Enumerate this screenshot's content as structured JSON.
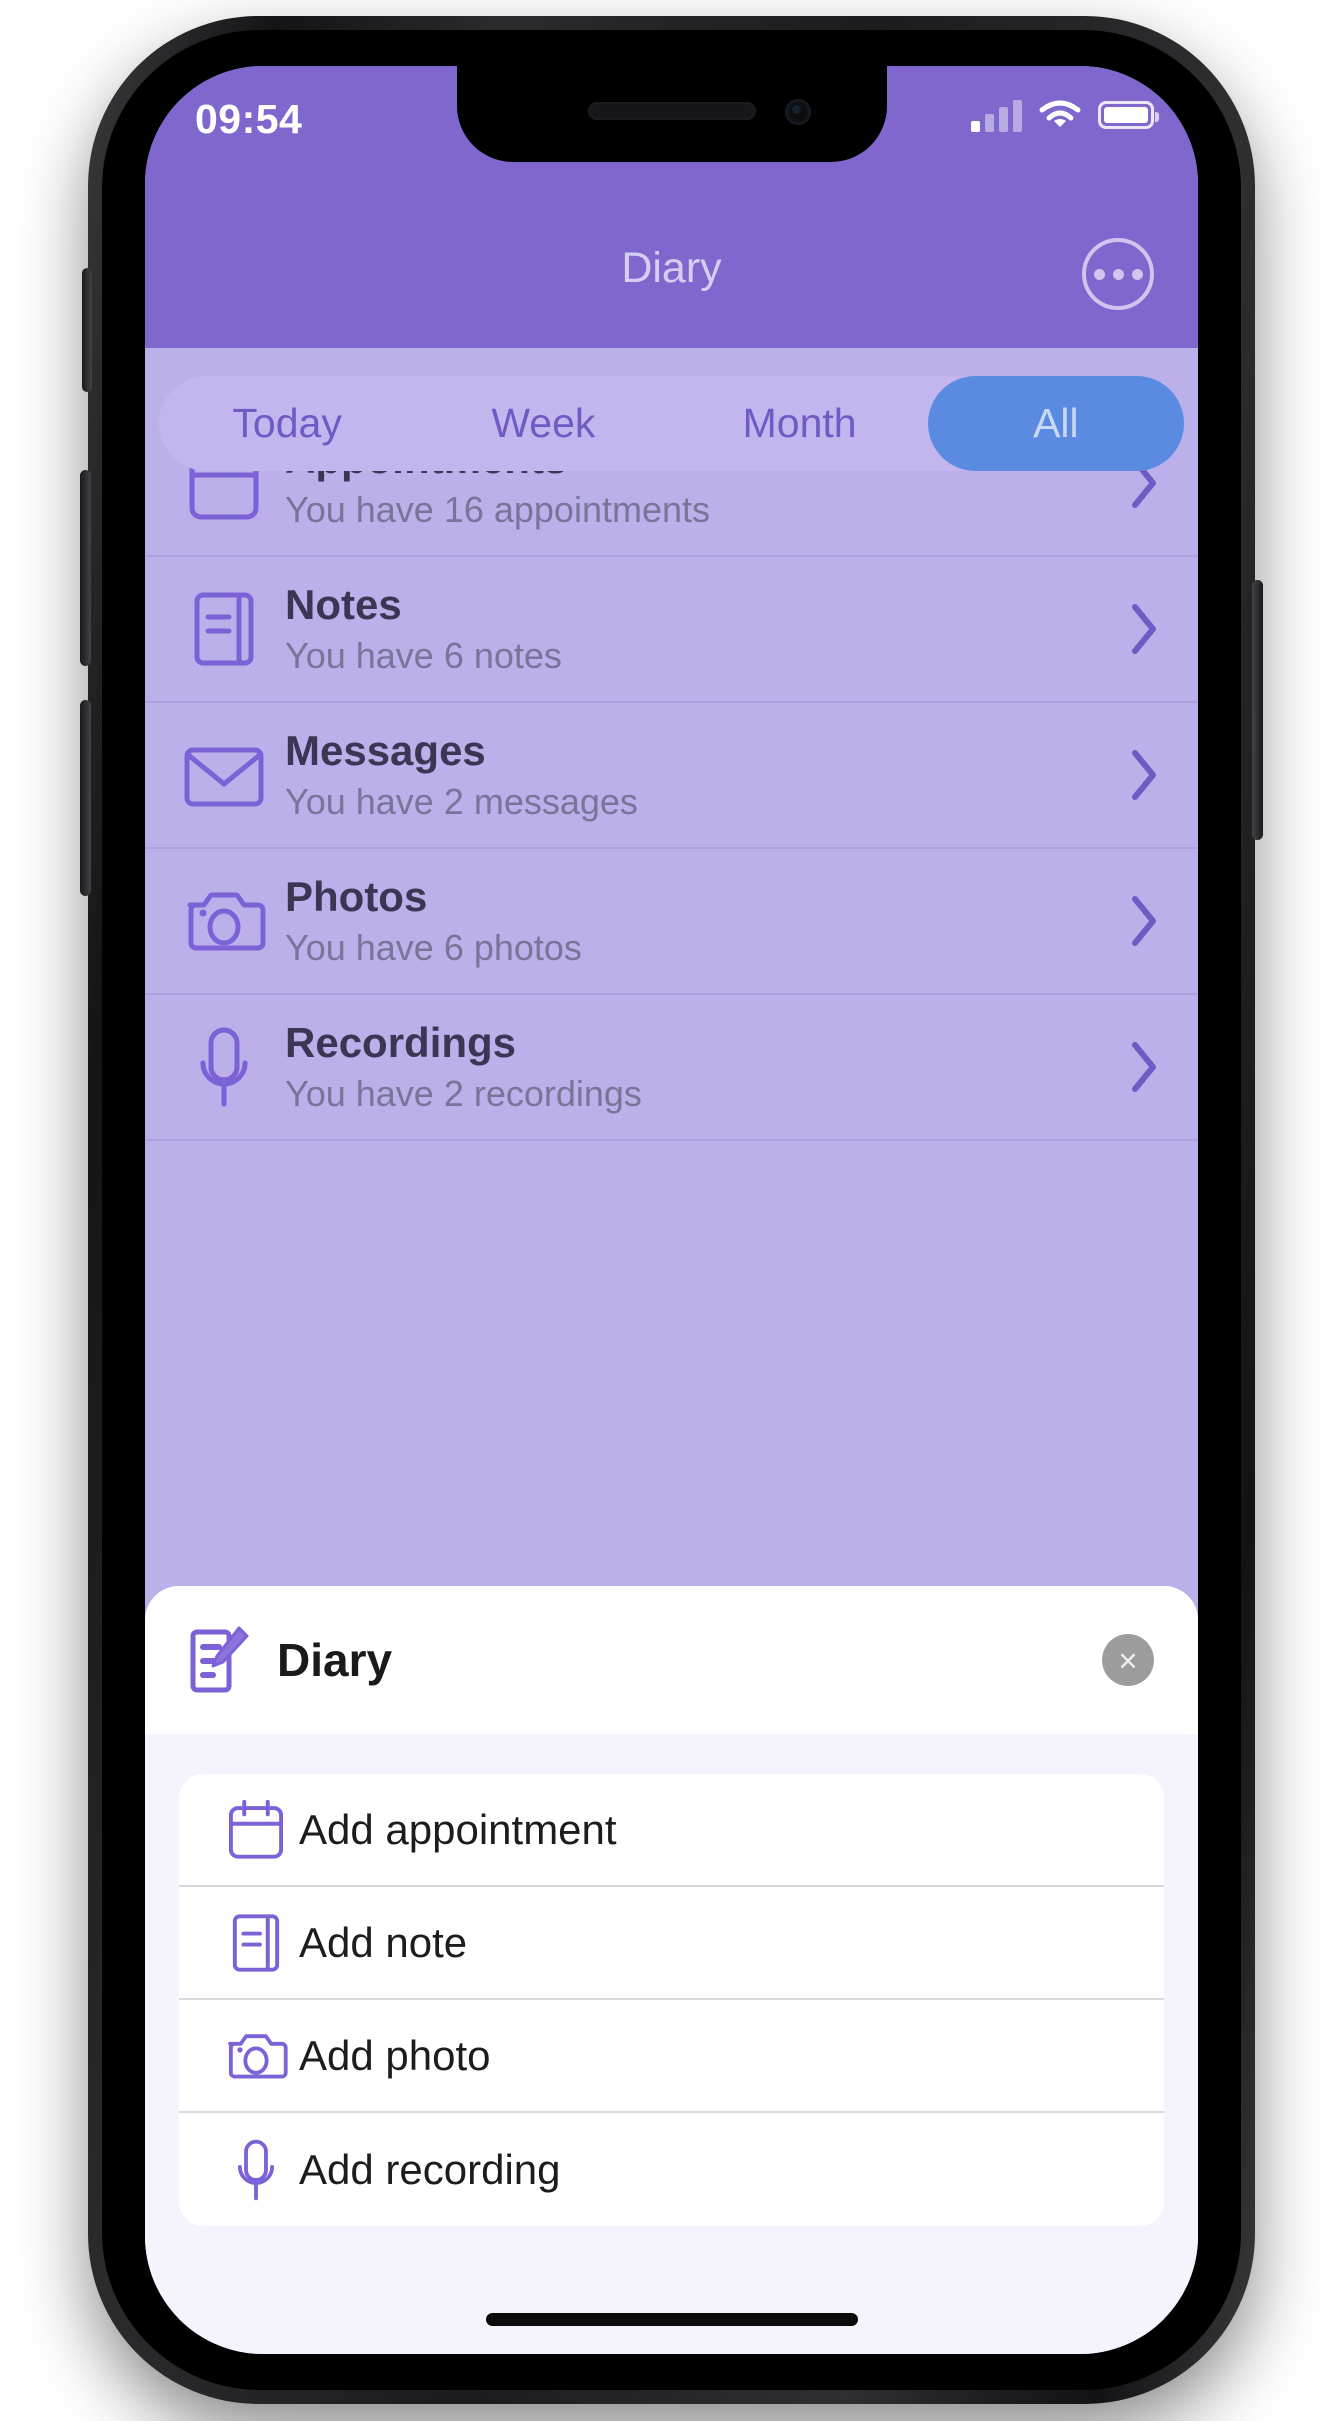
{
  "colors": {
    "header_purple": "#7F67CE",
    "list_purple": "#BCB0EA",
    "segment_track": "#C3B6EE",
    "segment_active": "#5B8BE0",
    "icon_purple": "#7C62D6",
    "sheet_bg": "#F5F3FC"
  },
  "status_bar": {
    "time": "09:54",
    "signal_icon": "cellular-signal-icon",
    "wifi_icon": "wifi-icon",
    "battery_icon": "battery-full-icon"
  },
  "header": {
    "title": "Diary",
    "more_icon": "more-options-icon"
  },
  "segments": {
    "items": [
      {
        "label": "Today",
        "active": false
      },
      {
        "label": "Week",
        "active": false
      },
      {
        "label": "Month",
        "active": false
      },
      {
        "label": "All",
        "active": true
      }
    ]
  },
  "list": {
    "rows": [
      {
        "title": "Appointments",
        "subtitle": "You have 16 appointments",
        "icon": "calendar-icon"
      },
      {
        "title": "Notes",
        "subtitle": "You have 6 notes",
        "icon": "notebook-icon"
      },
      {
        "title": "Messages",
        "subtitle": "You have 2 messages",
        "icon": "envelope-icon"
      },
      {
        "title": "Photos",
        "subtitle": "You have 6 photos",
        "icon": "camera-icon"
      },
      {
        "title": "Recordings",
        "subtitle": "You have 2 recordings",
        "icon": "microphone-icon"
      }
    ]
  },
  "sheet": {
    "title": "Diary",
    "title_icon": "diary-pencil-icon",
    "close_label": "×",
    "menu": [
      {
        "label": "Add appointment",
        "icon": "calendar-icon"
      },
      {
        "label": "Add note",
        "icon": "notebook-icon"
      },
      {
        "label": "Add photo",
        "icon": "camera-icon"
      },
      {
        "label": "Add recording",
        "icon": "microphone-icon"
      }
    ]
  }
}
